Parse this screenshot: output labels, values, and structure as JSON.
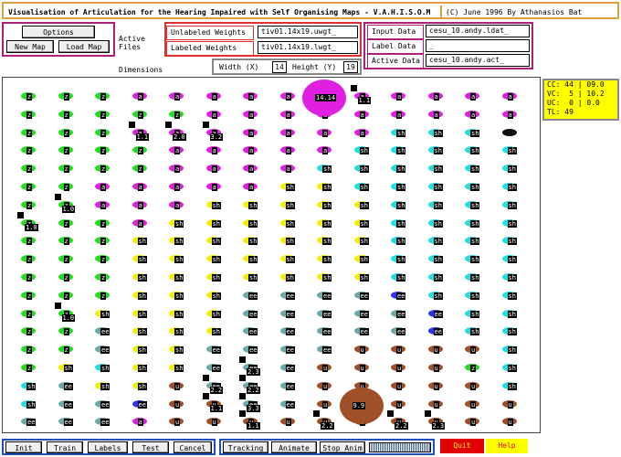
{
  "title": "Visualisation of Articulation for the Hearing Impaired with Self Organising Maps - V.A.H.I.S.O.M",
  "copyright": "(C) June 1996 By Athanasios Bat",
  "options": {
    "title": "Options",
    "new_map": "New Map",
    "load_map": "Load Map"
  },
  "active_files_label": "Active Files",
  "dimensions_label": "Dimensions",
  "weights": {
    "unlabeled_label": "Unlabeled Weights",
    "unlabeled_value": "tiv01.14x19.uwgt_",
    "labeled_label": "Labeled Weights",
    "labeled_value": "tiv01.14x19.lwgt_"
  },
  "dimensions": {
    "width_label": "Width (X)",
    "width_value": "14",
    "height_label": "Height (Y)",
    "height_value": "19"
  },
  "data_files": {
    "input_label": "Input Data",
    "input_value": "cesu_10.andy.ldat_",
    "label_label": "Label Data",
    "label_value": "_",
    "active_label": "Active Data",
    "active_value": "cesu_10.andy.act_"
  },
  "stats": [
    {
      "key": "CC:",
      "a": "44",
      "b": "09.0"
    },
    {
      "key": "VC:",
      "a": "5",
      "b": "10.2"
    },
    {
      "key": "UC:",
      "a": "0",
      "b": "0.0"
    },
    {
      "key": "TL:",
      "a": "49",
      "b": ""
    }
  ],
  "bottom_buttons": [
    "Init",
    "Train",
    "Labels",
    "Test",
    "Cancel"
  ],
  "bottom_buttons2": [
    "Tracking",
    "Animate",
    "Stop Anim"
  ],
  "quit_label": "Quit",
  "help_label": "Help",
  "colors": {
    "green": "#22dd22",
    "magenta": "#e020e0",
    "cyan": "#20e0e0",
    "yellow": "#f0f000",
    "gray": "#70a8a8",
    "brown": "#a05028",
    "blue": "#3030ff",
    "black": "#111111"
  },
  "map_rows": [
    "GGGMMMMMMMMMMM",
    "GGGGGMMMMMMMMM",
    "GGGMMMMMMMCCCK",
    "GGGGMMMMMCCCCC",
    "GGGGMMMMCCCCCC",
    "GGMMMMMYYCCCCC",
    "GGMMMYYYYYCCCC",
    "GGGMYYYYYYCCCC",
    "GGGYYYYYYYCCCC",
    "GGGYYYYYYYCCCC",
    "GGGYYYYYYYCCCC",
    "GGGYYYEEEEBCCC",
    "GGYYYYEEEEEBCC",
    "GGEYYYEEEEEBCC",
    "GGEYYEEEERRRRC",
    "GYCYYEEERRRRGC",
    "CEYYREEERRRRRC",
    "CEEBRREERRRRRR",
    "EEEMRRRRRRRRRR"
  ],
  "map_labels": [
    "a",
    "a",
    "a",
    "a",
    "a",
    "a",
    "a",
    "a",
    "a",
    "a",
    "a",
    "a",
    "a",
    "a"
  ],
  "labels_by_color": {
    "G": "z",
    "M": "a",
    "C": "sh",
    "Y": "sh",
    "E": "ee",
    "R": "u",
    "B": "ee",
    "K": ""
  },
  "big_nodes": [
    {
      "label": "14.14",
      "color": "magenta",
      "col": 8,
      "row": 0
    },
    {
      "label": "9.9",
      "color": "brown",
      "col": 9,
      "row": 17
    }
  ],
  "value_labels": [
    {
      "text": "1.1",
      "col": 9,
      "row": 0
    },
    {
      "text": "1.1",
      "col": 3,
      "row": 2
    },
    {
      "text": "2.0",
      "col": 4,
      "row": 2
    },
    {
      "text": "3.2",
      "col": 5,
      "row": 2
    },
    {
      "text": "1.0",
      "col": 1,
      "row": 6
    },
    {
      "text": "1.0",
      "col": 0,
      "row": 7
    },
    {
      "text": "1.0",
      "col": 1,
      "row": 12
    },
    {
      "text": "2.2",
      "col": 5,
      "row": 16
    },
    {
      "text": "2.3",
      "col": 6,
      "row": 15
    },
    {
      "text": "2.2",
      "col": 6,
      "row": 16
    },
    {
      "text": "1.1",
      "col": 5,
      "row": 17
    },
    {
      "text": "3.3",
      "col": 6,
      "row": 17
    },
    {
      "text": "1.1",
      "col": 6,
      "row": 18
    },
    {
      "text": "2.2",
      "col": 8,
      "row": 18
    },
    {
      "text": "2.2",
      "col": 10,
      "row": 18
    },
    {
      "text": "2.3",
      "col": 11,
      "row": 18
    }
  ]
}
